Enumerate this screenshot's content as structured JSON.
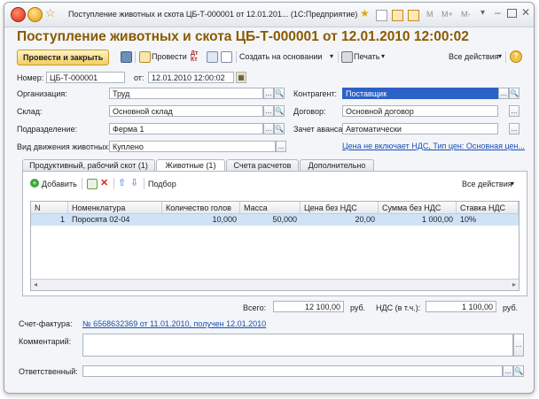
{
  "window": {
    "title": "Поступление животных и скота ЦБ-Т-000001 от 12.01.201... (1С:Предприятие)",
    "right_tools": [
      "M",
      "M+",
      "M-"
    ]
  },
  "document": {
    "title": "Поступление животных и скота ЦБ-Т-000001 от 12.01.2010 12:00:02"
  },
  "toolbar": {
    "post_close": "Провести и закрыть",
    "post": "Провести",
    "create_based": "Создать на основании",
    "print": "Печать",
    "all_actions": "Все действия",
    "help": "?"
  },
  "form": {
    "number_label": "Номер:",
    "number_value": "ЦБ-Т-000001",
    "date_label": "от:",
    "date_value": "12.01.2010 12:00:02",
    "org_label": "Организация:",
    "org_value": "Труд",
    "counterparty_label": "Контрагент:",
    "counterparty_value": "Поставщик",
    "warehouse_label": "Склад:",
    "warehouse_value": "Основной склад",
    "contract_label": "Договор:",
    "contract_value": "Основной договор",
    "division_label": "Подразделение:",
    "division_value": "Ферма 1",
    "advance_label": "Зачет аванса:",
    "advance_value": "Автоматически",
    "movement_label": "Вид движения животных:",
    "movement_value": "Куплено",
    "price_link": "Цена не включает НДС, Тип цен: Основная цен..."
  },
  "tabs": [
    {
      "label": "Продуктивный, рабочий скот (1)"
    },
    {
      "label": "Животные (1)"
    },
    {
      "label": "Счета расчетов"
    },
    {
      "label": "Дополнительно"
    }
  ],
  "table_toolbar": {
    "add": "Добавить",
    "selection": "Подбор",
    "all_actions": "Все действия"
  },
  "table": {
    "columns": [
      "N",
      "Номенклатура",
      "Количество голов",
      "Масса",
      "Цена без НДС",
      "Сумма без НДС",
      "Ставка НДС"
    ],
    "rows": [
      {
        "n": "1",
        "item": "Поросята 02-04",
        "heads": "10,000",
        "mass": "50,000",
        "price": "20,00",
        "sum": "1 000,00",
        "vat_rate": "10%"
      }
    ]
  },
  "totals": {
    "total_label": "Всего:",
    "total_value": "12 100,00",
    "currency": "руб.",
    "vat_label": "НДС (в т.ч.):",
    "vat_value": "1 100,00",
    "vat_currency": "руб."
  },
  "invoice": {
    "label": "Счет-фактура:",
    "link": "№ 6568632369 от 11.01.2010, получен 12.01.2010"
  },
  "comment_label": "Комментарий:",
  "responsible_label": "Ответственный:",
  "colors": {
    "title": "#8a5a00",
    "selection": "#2c62c8",
    "link": "#1a4fb3",
    "row_highlight": "#cfe2f7"
  }
}
